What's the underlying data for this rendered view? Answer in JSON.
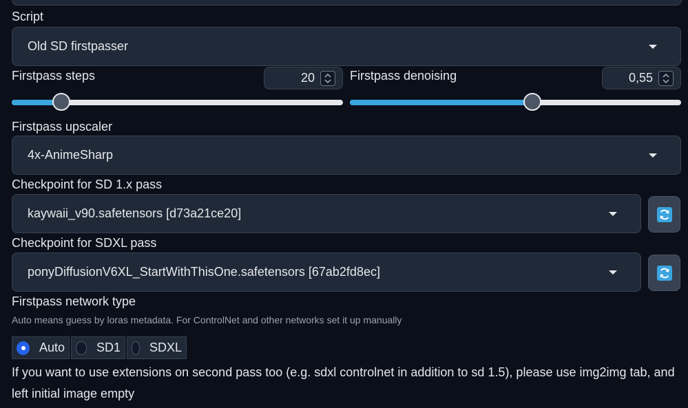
{
  "script": {
    "label": "Script",
    "selected": "Old SD firstpasser"
  },
  "firstpass_steps": {
    "label": "Firstpass steps",
    "value": "20",
    "slider_fraction": 0.15
  },
  "firstpass_denoising": {
    "label": "Firstpass denoising",
    "value": "0,55",
    "slider_fraction": 0.55
  },
  "upscaler": {
    "label": "Firstpass upscaler",
    "selected": "4x-AnimeSharp"
  },
  "checkpoint_sd1": {
    "label": "Checkpoint for SD 1.x pass",
    "selected": "kaywaii_v90.safetensors [d73a21ce20]"
  },
  "checkpoint_sdxl": {
    "label": "Checkpoint for SDXL pass",
    "selected": "ponyDiffusionV6XL_StartWithThisOne.safetensors [67ab2fd8ec]"
  },
  "network_type": {
    "label": "Firstpass network type",
    "info": "Auto means guess by loras metadata. For ControlNet and other networks set it up manually",
    "options": [
      "Auto",
      "SD1",
      "SDXL"
    ],
    "selected": "Auto"
  },
  "note": "If you want to use extensions on second pass too (e.g. sdxl controlnet in addition to sd 1.5), please use img2img tab, and left initial image empty",
  "colors": {
    "background": "#0b0f19",
    "panel": "#1f2937",
    "accent": "#3ba5e0",
    "radio_selected": "#2563eb",
    "refresh_icon": "#3ba5e0"
  }
}
